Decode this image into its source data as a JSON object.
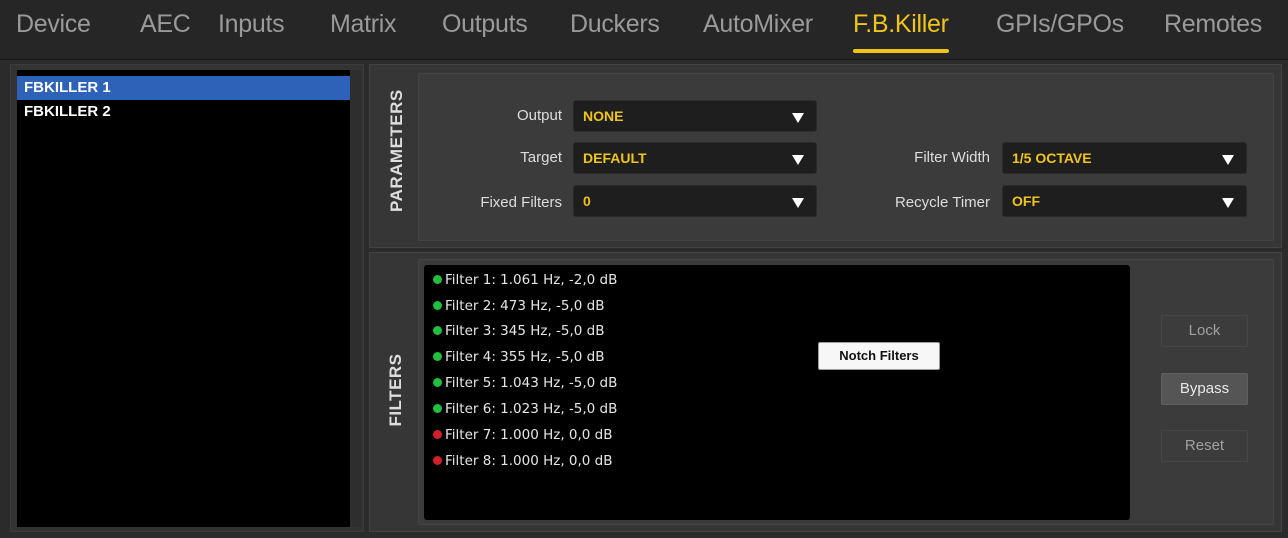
{
  "nav": {
    "tabs": [
      {
        "label": "Device",
        "active": false
      },
      {
        "label": "AEC",
        "active": false
      },
      {
        "label": "Inputs",
        "active": false
      },
      {
        "label": "Matrix",
        "active": false
      },
      {
        "label": "Outputs",
        "active": false
      },
      {
        "label": "Duckers",
        "active": false
      },
      {
        "label": "AutoMixer",
        "active": false
      },
      {
        "label": "F.B.Killer",
        "active": true
      },
      {
        "label": "GPIs/GPOs",
        "active": false
      },
      {
        "label": "Remotes",
        "active": false
      }
    ]
  },
  "instances": {
    "items": [
      {
        "label": "FBKILLER 1",
        "selected": true
      },
      {
        "label": "FBKILLER 2",
        "selected": false
      }
    ]
  },
  "parameters": {
    "section_label": "PARAMETERS",
    "output": {
      "label": "Output",
      "value": "NONE"
    },
    "target": {
      "label": "Target",
      "value": "DEFAULT"
    },
    "fixed_filters": {
      "label": "Fixed Filters",
      "value": "0"
    },
    "filter_width": {
      "label": "Filter Width",
      "value": "1/5 OCTAVE"
    },
    "recycle_timer": {
      "label": "Recycle Timer",
      "value": "OFF"
    }
  },
  "filters": {
    "section_label": "FILTERS",
    "tooltip": "Notch Filters",
    "rows": [
      {
        "text": "Filter 1: 1.061 Hz, -2,0 dB",
        "status": "active"
      },
      {
        "text": "Filter 2: 473 Hz, -5,0 dB",
        "status": "active"
      },
      {
        "text": "Filter 3: 345 Hz, -5,0 dB",
        "status": "active"
      },
      {
        "text": "Filter 4: 355 Hz, -5,0 dB",
        "status": "active"
      },
      {
        "text": "Filter 5: 1.043 Hz, -5,0 dB",
        "status": "active"
      },
      {
        "text": "Filter 6: 1.023 Hz, -5,0 dB",
        "status": "active"
      },
      {
        "text": "Filter 7: 1.000 Hz, 0,0 dB",
        "status": "inactive"
      },
      {
        "text": "Filter 8: 1.000 Hz, 0,0 dB",
        "status": "inactive"
      }
    ],
    "buttons": {
      "lock": "Lock",
      "bypass": "Bypass",
      "reset": "Reset"
    }
  },
  "colors": {
    "accent": "#f0c419",
    "selection": "#2d62b8",
    "status_active": "#1fbf3f",
    "status_inactive": "#d0202a"
  }
}
